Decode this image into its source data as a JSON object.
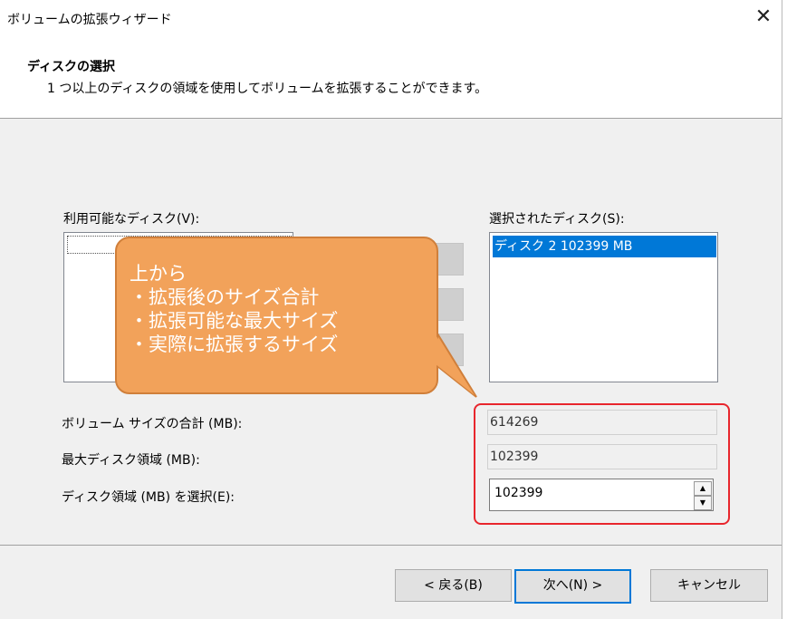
{
  "window": {
    "title": "ボリュームの拡張ウィザード",
    "close_glyph": "✕"
  },
  "header": {
    "title": "ディスクの選択",
    "subtitle": "1 つ以上のディスクの領域を使用してボリュームを拡張することができます。"
  },
  "available": {
    "label": "利用可能なディスク(V):"
  },
  "selected": {
    "label": "選択されたディスク(S):",
    "items": [
      "ディスク 2     102399 MB"
    ]
  },
  "fields": {
    "total_label": "ボリューム サイズの合計 (MB):",
    "total_value": "614269",
    "max_label": "最大ディスク領域 (MB):",
    "max_value": "102399",
    "select_label": "ディスク領域 (MB) を選択(E):",
    "select_value": "102399"
  },
  "callout": {
    "text": "上から\n・拡張後のサイズ合計\n・拡張可能な最大サイズ\n・実際に拡張するサイズ",
    "color": "#f2a25a"
  },
  "highlight_color": "#e8262d",
  "buttons": {
    "back": "< 戻る(B)",
    "next": "次へ(N) >",
    "cancel": "キャンセル"
  }
}
